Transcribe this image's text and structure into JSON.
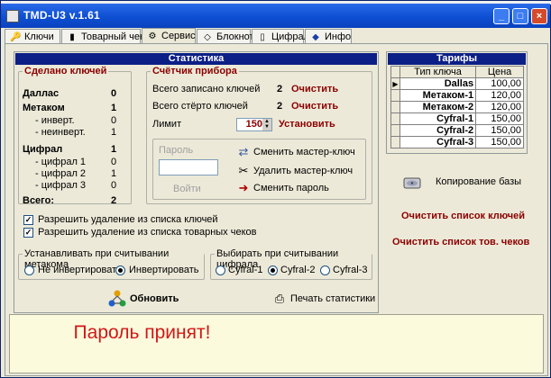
{
  "window": {
    "title": "TMD-U3 v.1.61",
    "buttons": {
      "minimize": "_",
      "maximize": "□",
      "close": "×"
    }
  },
  "tabs": [
    {
      "label": "Ключи",
      "icon": "key-icon"
    },
    {
      "label": "Товарный чек",
      "icon": "receipt-icon"
    },
    {
      "label": "Сервис",
      "icon": "gear-icon"
    },
    {
      "label": "Блокнот",
      "icon": "notepad-icon"
    },
    {
      "label": "Цифрал",
      "icon": "device-icon"
    },
    {
      "label": "Инфо",
      "icon": "book-icon"
    }
  ],
  "active_tab": "Сервис",
  "stats": {
    "header": "Статистика",
    "made_keys": {
      "title": "Сделано ключей",
      "dallas_label": "Даллас",
      "dallas_value": "0",
      "metakom_label": "Метаком",
      "metakom_value": "1",
      "invert_label": "- инверт.",
      "invert_value": "0",
      "noninvert_label": "- неинверт.",
      "noninvert_value": "1",
      "cyfral_label": "Цифрал",
      "cyfral_value": "1",
      "cyfral1_label": "- цифрал 1",
      "cyfral1_value": "0",
      "cyfral2_label": "- цифрал 2",
      "cyfral2_value": "1",
      "cyfral3_label": "- цифрал 3",
      "cyfral3_value": "0",
      "total_label": "Всего:",
      "total_value": "2"
    },
    "counter": {
      "title": "Счётчик прибора",
      "written_label": "Всего записано ключей",
      "written_value": "2",
      "erased_label": "Всего стёрто ключей",
      "erased_value": "2",
      "limit_label": "Лимит",
      "limit_value": "150",
      "clear_label": "Очистить",
      "set_label": "Установить",
      "password_label": "Пароль",
      "login_label": "Войти",
      "change_master": "Сменить мастер-ключ",
      "delete_master": "Удалить мастер-ключ",
      "change_password": "Сменить пароль"
    },
    "allow_delete_keys": "Разрешить удаление из списка ключей",
    "allow_delete_receipts": "Разрешить удаление из списка товарных чеков",
    "metakom_group": {
      "title": "Устанавливать при считывании метакома",
      "options": [
        "Не инвертировать",
        "Инвертировать"
      ],
      "selected": 1
    },
    "cyfral_group": {
      "title": "Выбирать при считывании цифрала",
      "options": [
        "Cyfral-1",
        "Cyfral-2",
        "Cyfral-3"
      ],
      "selected": 1
    },
    "refresh_label": "Обновить",
    "print_label": "Печать статистики"
  },
  "tariffs": {
    "header": "Тарифы",
    "columns": [
      "Тип ключа",
      "Цена"
    ],
    "rows": [
      {
        "type": "Dallas",
        "price": "100,00"
      },
      {
        "type": "Метаком-1",
        "price": "120,00"
      },
      {
        "type": "Метаком-2",
        "price": "120,00"
      },
      {
        "type": "Cyfral-1",
        "price": "150,00"
      },
      {
        "type": "Cyfral-2",
        "price": "150,00"
      },
      {
        "type": "Cyfral-3",
        "price": "150,00"
      }
    ]
  },
  "side_actions": {
    "copy_db": "Копирование базы",
    "clear_keys": "Очистить список ключей",
    "clear_receipts": "Очистить список тов. чеков"
  },
  "status": {
    "message": "Пароль принят!"
  },
  "colors": {
    "accent_red": "#8b0000",
    "header_blue": "#0c1f86",
    "status_red": "#d01818"
  }
}
